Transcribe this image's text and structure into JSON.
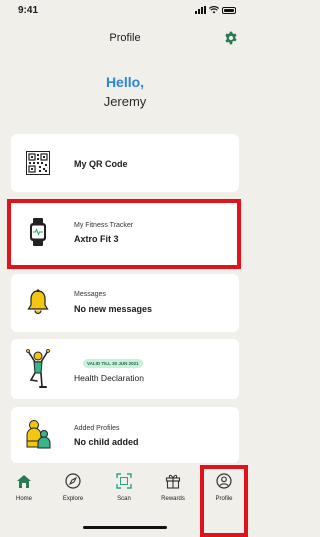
{
  "status": {
    "time": "9:41"
  },
  "header": {
    "title": "Profile"
  },
  "greeting": {
    "hello": "Hello,",
    "name": "Jeremy"
  },
  "cards": {
    "qr": {
      "title": "My QR Code"
    },
    "tracker": {
      "subtitle": "My Fitness Tracker",
      "title": "Axtro Fit 3"
    },
    "messages": {
      "subtitle": "Messages",
      "title": "No new messages"
    },
    "health": {
      "badge": "VALID TILL 30 JUN 2021",
      "title": "Health Declaration"
    },
    "profiles": {
      "subtitle": "Added Profiles",
      "title": "No child added"
    }
  },
  "tabs": [
    {
      "label": "Home"
    },
    {
      "label": "Explore"
    },
    {
      "label": "Scan"
    },
    {
      "label": "Rewards"
    },
    {
      "label": "Profile"
    }
  ],
  "colors": {
    "accent_green": "#2c7a52",
    "hello_blue": "#2a86e0",
    "highlight_red": "#e0121b"
  }
}
